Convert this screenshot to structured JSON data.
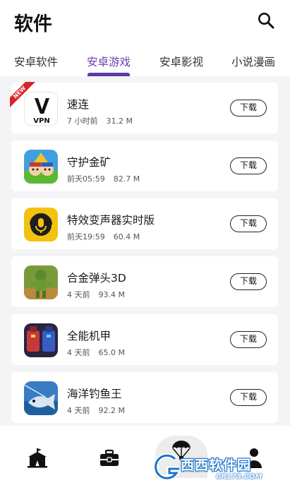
{
  "header": {
    "title": "软件"
  },
  "tabs": [
    {
      "label": "安卓软件"
    },
    {
      "label": "安卓游戏",
      "active": true
    },
    {
      "label": "安卓影视"
    },
    {
      "label": "小说漫画"
    }
  ],
  "apps": [
    {
      "name": "速连",
      "time": "7 小时前",
      "size": "31.2 M",
      "icon": "vpn-app-icon",
      "badge": "NEW",
      "action": "下载"
    },
    {
      "name": "守护金矿",
      "time": "前天05:59",
      "size": "82.7 M",
      "icon": "gold-mine-game-icon",
      "action": "下载"
    },
    {
      "name": "特效变声器实时版",
      "time": "前天19:59",
      "size": "60.4 M",
      "icon": "voice-changer-app-icon",
      "action": "下载"
    },
    {
      "name": "合金弹头3D",
      "time": "4 天前",
      "size": "93.4 M",
      "icon": "metal-slug-game-icon",
      "action": "下载"
    },
    {
      "name": "全能机甲",
      "time": "4 天前",
      "size": "65.0 M",
      "icon": "mecha-game-icon",
      "action": "下载"
    },
    {
      "name": "海洋钓鱼王",
      "time": "4 天前",
      "size": "92.2 M",
      "icon": "fishing-game-icon",
      "action": "下载"
    }
  ],
  "bottom_nav": [
    {
      "icon": "circus-tent-icon"
    },
    {
      "icon": "toolbox-icon"
    },
    {
      "icon": "parachute-icon",
      "active": true
    },
    {
      "icon": "profile-icon"
    }
  ],
  "watermark": {
    "text": "西西软件园",
    "sub": "CR173.COM"
  },
  "colors": {
    "accent": "#6a3fb0",
    "indicator": "#5e3aa0",
    "background": "#f4f4f6",
    "badge": "#d9262b"
  }
}
